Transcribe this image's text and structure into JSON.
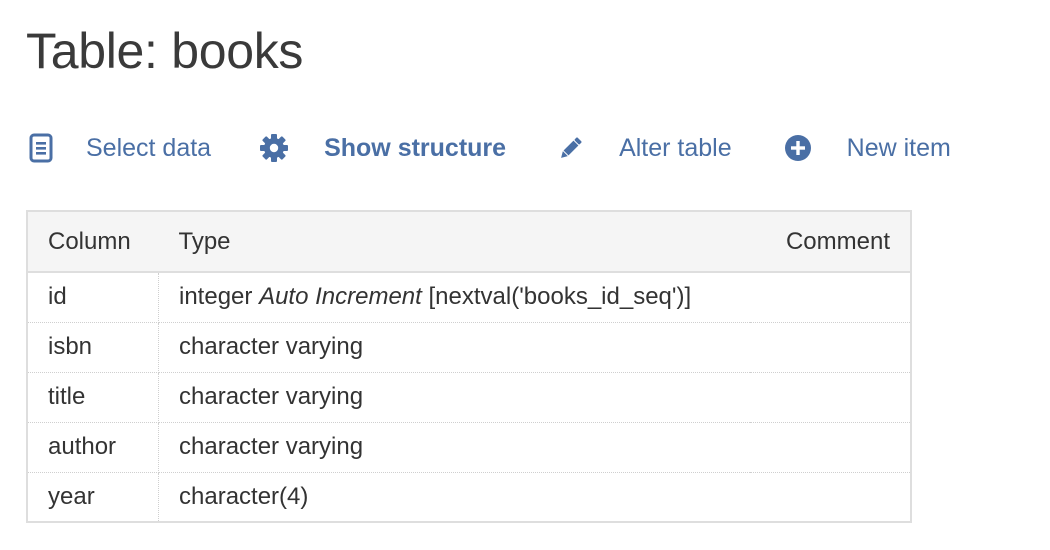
{
  "page": {
    "title": "Table: books"
  },
  "toolbar": {
    "items": [
      {
        "label": "Select data",
        "icon": "document-list-icon",
        "active": false
      },
      {
        "label": "Show structure",
        "icon": "gear-icon",
        "active": true
      },
      {
        "label": "Alter table",
        "icon": "pencil-icon",
        "active": false
      },
      {
        "label": "New item",
        "icon": "plus-circle-icon",
        "active": false
      }
    ]
  },
  "table": {
    "headers": {
      "column": "Column",
      "type": "Type",
      "comment": "Comment"
    },
    "rows": [
      {
        "column": "id",
        "type": "integer",
        "type_extra": "Auto Increment",
        "type_default": "[nextval('books_id_seq')]",
        "comment": ""
      },
      {
        "column": "isbn",
        "type": "character varying",
        "type_extra": "",
        "type_default": "",
        "comment": ""
      },
      {
        "column": "title",
        "type": "character varying",
        "type_extra": "",
        "type_default": "",
        "comment": ""
      },
      {
        "column": "author",
        "type": "character varying",
        "type_extra": "",
        "type_default": "",
        "comment": ""
      },
      {
        "column": "year",
        "type": "character(4)",
        "type_extra": "",
        "type_default": "",
        "comment": ""
      }
    ]
  },
  "colors": {
    "link": "#4a6fa5",
    "title": "#3a3a3a",
    "header_bg": "#f5f5f5",
    "border": "#dedede"
  }
}
